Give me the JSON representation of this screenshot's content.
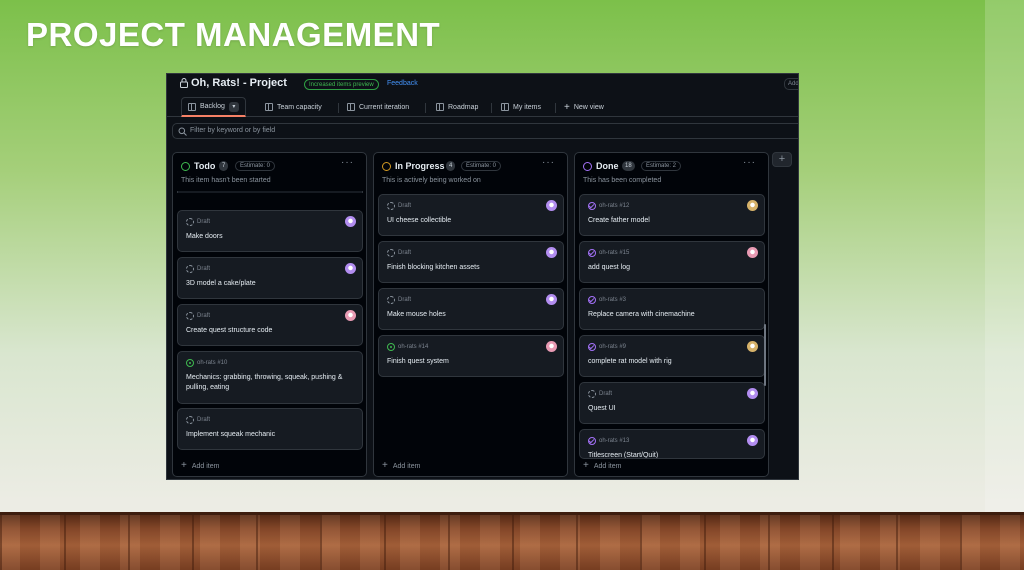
{
  "slide": {
    "title": "PROJECT MANAGEMENT"
  },
  "app": {
    "title": "Oh, Rats! - Project",
    "badge": "Increased items preview",
    "feedback": "Feedback",
    "edge_button": "Add"
  },
  "tabs": [
    {
      "label": "Backlog",
      "active": true
    },
    {
      "label": "Team capacity"
    },
    {
      "label": "Current iteration"
    },
    {
      "label": "Roadmap"
    },
    {
      "label": "My items"
    },
    {
      "label": "New view"
    }
  ],
  "filter": {
    "placeholder": "Filter by keyword or by field"
  },
  "columns": [
    {
      "name": "Todo",
      "count": "7",
      "estimate": "Estimate: 0",
      "description": "This item hasn't been started",
      "status_color": "#3fb950",
      "add_label": "Add item",
      "cards": [
        {
          "meta": "Draft",
          "title": "Make doors",
          "avatar": "purple"
        },
        {
          "meta": "Draft",
          "title": "3D model a cake/plate",
          "avatar": "purple"
        },
        {
          "meta": "Draft",
          "title": "Create quest structure code",
          "avatar": "pink"
        },
        {
          "meta": "oh-rats #10",
          "title": "Mechanics: grabbing, throwing, squeak, pushing & pulling, eating",
          "avatar": ""
        },
        {
          "meta": "Draft",
          "title": "Implement squeak mechanic",
          "avatar": ""
        }
      ]
    },
    {
      "name": "In Progress",
      "count": "4",
      "estimate": "Estimate: 0",
      "description": "This is actively being worked on",
      "status_color": "#d29922",
      "add_label": "Add item",
      "cards": [
        {
          "meta": "Draft",
          "title": "UI cheese collectible",
          "avatar": "purple"
        },
        {
          "meta": "Draft",
          "title": "Finish blocking kitchen assets",
          "avatar": "purple"
        },
        {
          "meta": "Draft",
          "title": "Make mouse holes",
          "avatar": "purple"
        },
        {
          "meta": "oh-rats #14",
          "title": "Finish quest system",
          "avatar": "pink"
        }
      ]
    },
    {
      "name": "Done",
      "count": "18",
      "estimate": "Estimate: 2",
      "description": "This has been completed",
      "status_color": "#a371f7",
      "add_label": "Add item",
      "cards": [
        {
          "meta": "oh-rats #12",
          "title": "Create father model",
          "avatar": "yellow"
        },
        {
          "meta": "oh-rats #15",
          "title": "add quest log",
          "avatar": "pink"
        },
        {
          "meta": "oh-rats #3",
          "title": "Replace camera with cinemachine",
          "avatar": ""
        },
        {
          "meta": "oh-rats #9",
          "title": "complete rat model with rig",
          "avatar": "yellow"
        },
        {
          "meta": "Draft",
          "title": "Quest UI",
          "avatar": "purple"
        },
        {
          "meta": "oh-rats #13",
          "title": "Titlescreen (Start/Quit)",
          "avatar": "purple"
        }
      ]
    }
  ]
}
